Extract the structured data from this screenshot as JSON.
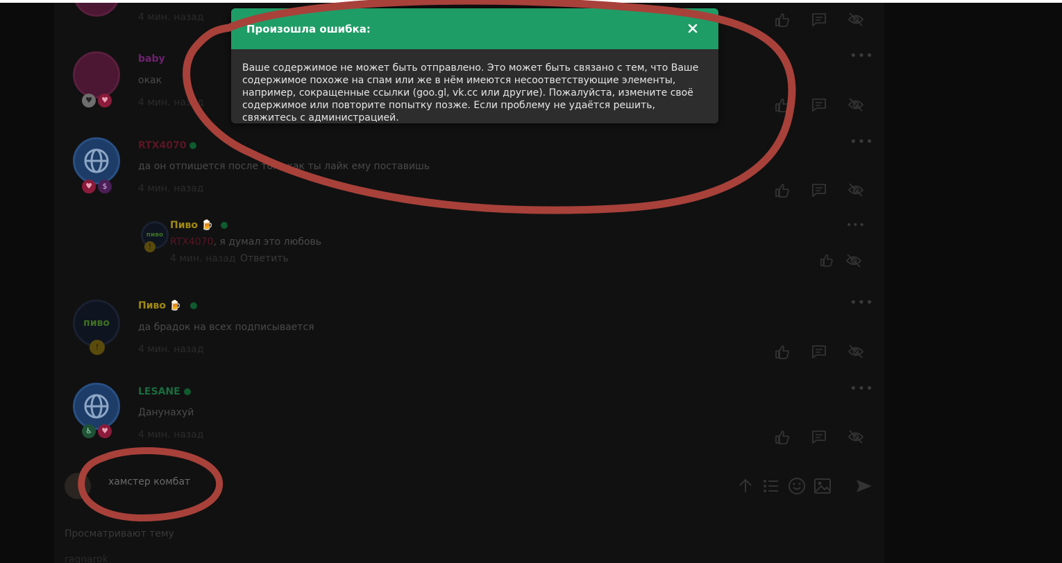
{
  "comments": [
    {
      "time": "4 мин. назад"
    },
    {
      "username": "baby",
      "text": "окак",
      "time": "4 мин. назад",
      "username_color": "#6e2270"
    },
    {
      "username": "RTX4070",
      "text": "да он отпишется после того как ты лайк ему поставишь",
      "time": "4 мин. назад",
      "username_color": "#5a1525"
    },
    {
      "username": "Пиво 🍺",
      "mention": "RTX4070",
      "text": ", я думал это любовь",
      "time": "4 мин. назад",
      "reply_label": "Ответить",
      "avatar_text": "пиво",
      "username_color": "#a08a10"
    },
    {
      "username": "Пиво 🍺",
      "text": "да брадок на всех подписывается",
      "time": "4 мин. назад",
      "avatar_text": "пиво",
      "username_color": "#a08a10"
    },
    {
      "username": "LESANE",
      "text": "Данунахуй",
      "time": "4 мин. назад",
      "username_color": "#1a6b3f"
    }
  ],
  "composer": {
    "value": "хамстер комбат"
  },
  "viewers": {
    "heading": "Просматривают тему",
    "first": "ragnarok"
  },
  "modal": {
    "title": "Произошла ошибка:",
    "body": "Ваше содержимое не может быть отправлено. Это может быть связано с тем, что Ваше содержимое похоже на спам или же в нём имеются несоответствующие элементы, например, сокращенные ссылки (goo.gl, vk.cc или другие). Пожалуйста, измените своё содержимое или повторите попытку позже. Если проблему не удаётся решить, свяжитесь с администрацией.",
    "header_color": "#1f9d67"
  },
  "annotation_color": "#a8413a"
}
